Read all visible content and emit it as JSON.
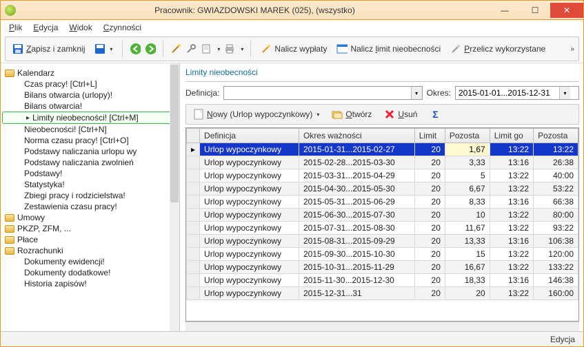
{
  "window": {
    "title": "Pracownik: GWIAZDOWSKI MAREK (025), (wszystko)"
  },
  "menu": {
    "plik": "Plik",
    "edycja": "Edycja",
    "widok": "Widok",
    "czynnosci": "Czynności"
  },
  "toolbar": {
    "zapisz": "Zapisz i zamknij",
    "nalicz_wyplaty": "Nalicz wypłaty",
    "nalicz_limit": "Nalicz limit nieobecności",
    "przelicz": "Przelicz wykorzystane"
  },
  "tree": {
    "kalendarz": "Kalendarz",
    "czas_pracy": "Czas pracy! [Ctrl+L]",
    "bilans_urlopy": "Bilans otwarcia (urlopy)!",
    "bilans": "Bilans otwarcia!",
    "limity": "Limity nieobecności! [Ctrl+M]",
    "nieobecnosci": "Nieobecności! [Ctrl+N]",
    "norma": "Norma czasu pracy! [Ctrl+O]",
    "podstawy_urlop": "Podstawy naliczania urlopu wy",
    "podstawy_zwoln": "Podstawy naliczania zwolnień",
    "podstawy": "Podstawy!",
    "statystyka": "Statystyka!",
    "zbiegi": "Zbiegi pracy i rodzicielstwa!",
    "zestawienia": "Zestawienia czasu pracy!",
    "umowy": "Umowy",
    "pkzp": "PKZP, ZFM, ...",
    "place": "Płace",
    "rozrachunki": "Rozrachunki",
    "dok_ewid": "Dokumenty ewidencji!",
    "dok_dodat": "Dokumenty dodatkowe!",
    "historia": "Historia zapisów!"
  },
  "panel": {
    "title": "Limity nieobecności",
    "definicja_label": "Definicja:",
    "okres_label": "Okres:",
    "okres_value": "2015-01-01...2015-12-31",
    "nowy": "Nowy (Urlop wypoczynkowy)",
    "otworz": "Otwórz",
    "usun": "Usuń"
  },
  "grid": {
    "cols": {
      "definicja": "Definicja",
      "okres": "Okres ważności",
      "limit": "Limit",
      "pozostalo": "Pozosta",
      "limitgodz": "Limit go",
      "pozostalo2": "Pozosta"
    },
    "rows": [
      {
        "def": "Urlop wypoczynkowy",
        "okres": "2015-01-31...2015-02-27",
        "limit": "20",
        "poz": "1,67",
        "lg": "13:22",
        "poz2": "13:22"
      },
      {
        "def": "Urlop wypoczynkowy",
        "okres": "2015-02-28...2015-03-30",
        "limit": "20",
        "poz": "3,33",
        "lg": "13:16",
        "poz2": "26:38"
      },
      {
        "def": "Urlop wypoczynkowy",
        "okres": "2015-03-31...2015-04-29",
        "limit": "20",
        "poz": "5",
        "lg": "13:22",
        "poz2": "40:00"
      },
      {
        "def": "Urlop wypoczynkowy",
        "okres": "2015-04-30...2015-05-30",
        "limit": "20",
        "poz": "6,67",
        "lg": "13:22",
        "poz2": "53:22"
      },
      {
        "def": "Urlop wypoczynkowy",
        "okres": "2015-05-31...2015-06-29",
        "limit": "20",
        "poz": "8,33",
        "lg": "13:16",
        "poz2": "66:38"
      },
      {
        "def": "Urlop wypoczynkowy",
        "okres": "2015-06-30...2015-07-30",
        "limit": "20",
        "poz": "10",
        "lg": "13:22",
        "poz2": "80:00"
      },
      {
        "def": "Urlop wypoczynkowy",
        "okres": "2015-07-31...2015-08-30",
        "limit": "20",
        "poz": "11,67",
        "lg": "13:22",
        "poz2": "93:22"
      },
      {
        "def": "Urlop wypoczynkowy",
        "okres": "2015-08-31...2015-09-29",
        "limit": "20",
        "poz": "13,33",
        "lg": "13:16",
        "poz2": "106:38"
      },
      {
        "def": "Urlop wypoczynkowy",
        "okres": "2015-09-30...2015-10-30",
        "limit": "20",
        "poz": "15",
        "lg": "13:22",
        "poz2": "120:00"
      },
      {
        "def": "Urlop wypoczynkowy",
        "okres": "2015-10-31...2015-11-29",
        "limit": "20",
        "poz": "16,67",
        "lg": "13:22",
        "poz2": "133:22"
      },
      {
        "def": "Urlop wypoczynkowy",
        "okres": "2015-11-30...2015-12-30",
        "limit": "20",
        "poz": "18,33",
        "lg": "13:16",
        "poz2": "146:38"
      },
      {
        "def": "Urlop wypoczynkowy",
        "okres": "2015-12-31...31",
        "limit": "20",
        "poz": "20",
        "lg": "13:22",
        "poz2": "160:00"
      }
    ]
  },
  "status": {
    "mode": "Edycja"
  }
}
